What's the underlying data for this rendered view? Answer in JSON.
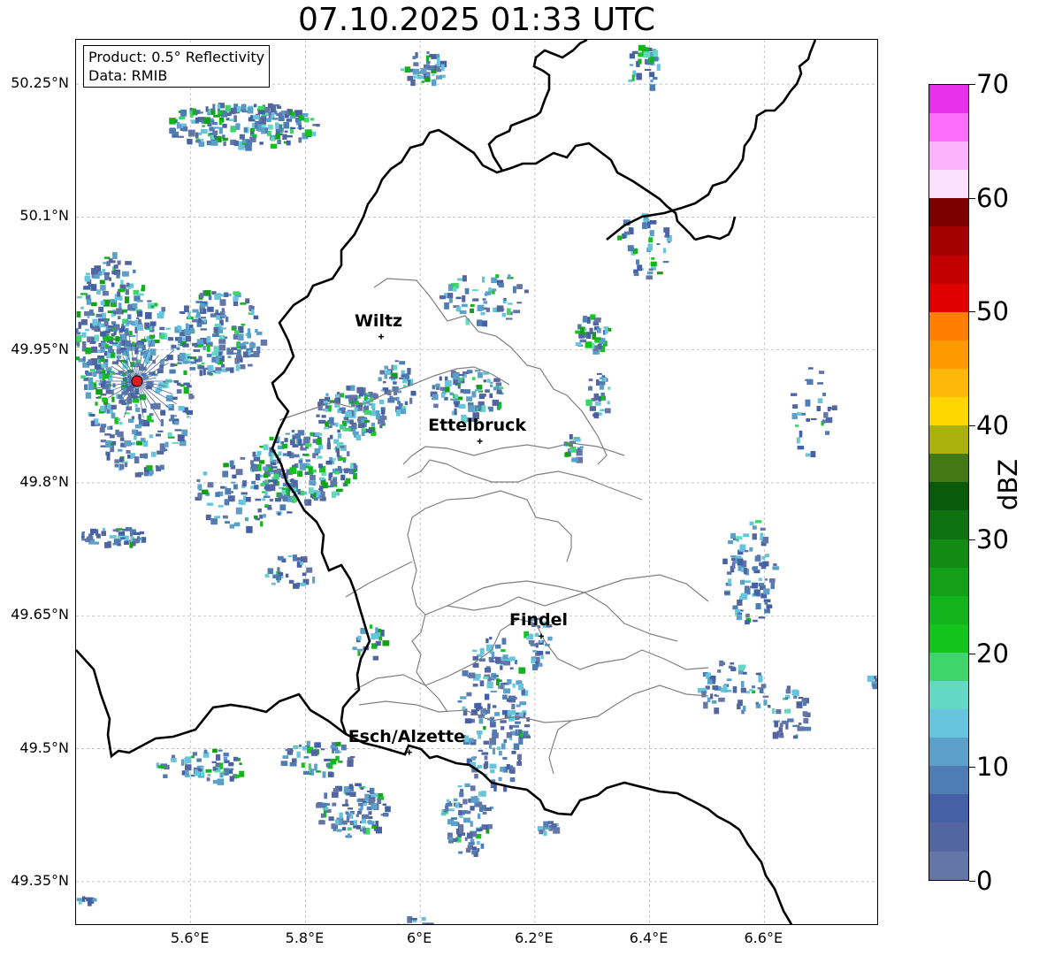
{
  "title": "07.10.2025 01:33 UTC",
  "info": {
    "product": "Product: 0.5° Reflectivity",
    "source": "Data: RMIB"
  },
  "map": {
    "lat_range": [
      49.3,
      50.3
    ],
    "lon_range": [
      5.4,
      6.8
    ],
    "grid": true,
    "lat_ticks": [
      "50.25°N",
      "50.1°N",
      "49.95°N",
      "49.8°N",
      "49.65°N",
      "49.5°N",
      "49.35°N"
    ],
    "lon_ticks": [
      "5.6°E",
      "5.8°E",
      "6°E",
      "6.2°E",
      "6.4°E",
      "6.6°E"
    ],
    "radar_site_color": "#e31a1c",
    "cities": [
      {
        "name": "Wiltz",
        "lat": 49.965,
        "lon": 5.932
      },
      {
        "name": "Ettelbruck",
        "lat": 49.847,
        "lon": 6.104
      },
      {
        "name": "Findel",
        "lat": 49.627,
        "lon": 6.211
      },
      {
        "name": "Esch/Alzette",
        "lat": 49.496,
        "lon": 5.981
      }
    ]
  },
  "colorbar": {
    "label": "dBZ",
    "min": 0,
    "max": 70,
    "tick_labels": [
      "0",
      "10",
      "20",
      "30",
      "40",
      "50",
      "60",
      "70"
    ],
    "colors": [
      "#6475a8",
      "#5366a0",
      "#4560a4",
      "#4e7cb3",
      "#5aa0c8",
      "#66c4dc",
      "#63d8c4",
      "#3fd46c",
      "#13c41c",
      "#12b31c",
      "#139f18",
      "#138a14",
      "#0e7212",
      "#0a5a0c",
      "#447816",
      "#aab10a",
      "#fed700",
      "#feb809",
      "#fe9a00",
      "#fe7e00",
      "#e10000",
      "#c20000",
      "#a30000",
      "#7a0000",
      "#fde0fd",
      "#fdb2fd",
      "#fd6efd",
      "#e831e8"
    ]
  }
}
